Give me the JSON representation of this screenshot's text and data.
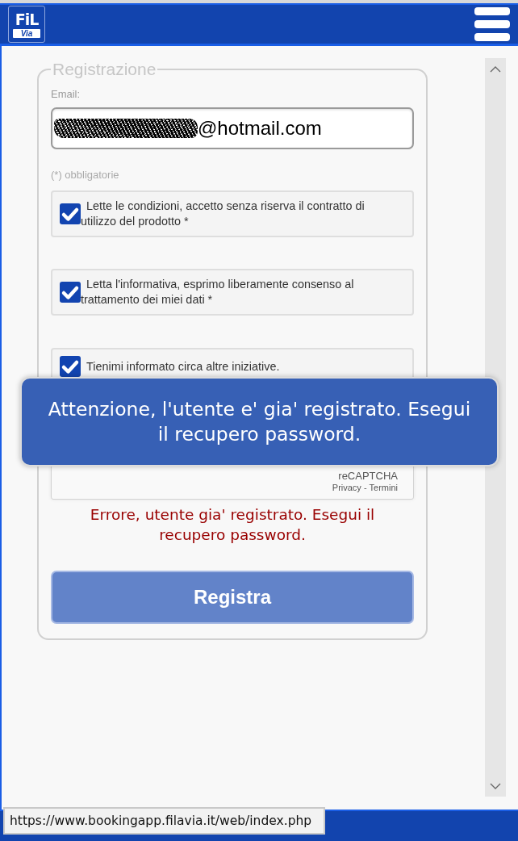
{
  "header": {
    "logo": {
      "top": "FiL",
      "bottom": "Via"
    }
  },
  "form": {
    "legend": "Registrazione",
    "email": {
      "label": "Email:",
      "value": "@hotmail.com",
      "redacted": true
    },
    "required_note": "(*) obbligatorie",
    "checkboxes": [
      {
        "label": "Lette le condizioni, accetto senza riserva il contratto di utilizzo del prodotto *",
        "checked": true
      },
      {
        "label": "Letta l'informativa, esprimo liberamente consenso al trattamento dei miei dati *",
        "checked": true
      },
      {
        "label": "Tienimi informato circa altre iniziative.",
        "checked": true
      }
    ],
    "recaptcha": {
      "brand": "reCAPTCHA",
      "links": [
        {
          "label": "Privacy"
        },
        {
          "label": "Termini"
        }
      ],
      "separator": "-"
    },
    "error": "Errore, utente gia' registrato. Esegui il recupero password.",
    "submit": "Registra"
  },
  "toast": {
    "message": "Attenzione, l'utente e' gia' registrato. Esegui il recupero password."
  },
  "status_tooltip": {
    "url": "https://www.bookingapp.filavia.it/web/index.php"
  }
}
